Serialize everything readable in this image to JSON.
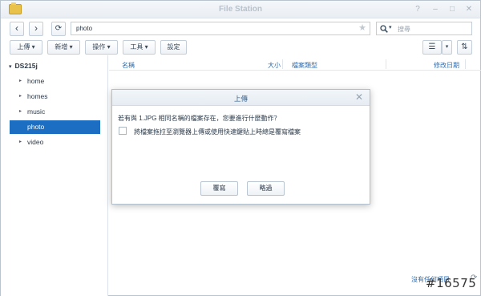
{
  "window": {
    "title": "File Station",
    "controls": [
      "?",
      "–",
      "□",
      "✕"
    ]
  },
  "nav": {
    "back": "‹",
    "forward": "›",
    "refresh": "⟳"
  },
  "path": {
    "value": "photo",
    "star": "★"
  },
  "search": {
    "placeholder": "搜尋",
    "icon": "search-icon",
    "dropdown": "▾"
  },
  "toolbar": {
    "upload": "上傳 ▾",
    "create": "新增 ▾",
    "action": "操作 ▾",
    "tools": "工具 ▾",
    "settings": "設定",
    "view_menu": "☰",
    "view_dropdown": "▾",
    "sort": "⇅"
  },
  "sidebar": {
    "root": "DS215j",
    "root_arrow": "▾",
    "items": [
      {
        "label": "home",
        "arrow": "▸"
      },
      {
        "label": "homes",
        "arrow": "▸"
      },
      {
        "label": "music",
        "arrow": "▸"
      },
      {
        "label": "photo",
        "arrow": ""
      },
      {
        "label": "video",
        "arrow": "▸"
      }
    ],
    "selected": "photo"
  },
  "list": {
    "columns": [
      "名稱",
      "大小",
      "檔案類型",
      "修改日期"
    ]
  },
  "status": {
    "text": "沒有任何項目",
    "refresh": "⟳"
  },
  "watermark": "#16575",
  "dialog": {
    "title": "上傳",
    "close": "✕",
    "message": "若有與 1.JPG 相同名稱的檔案存在，您要進行什麼動作？",
    "checkbox_label": "將檔案拖拉至瀏覽器上傳或使用快速鍵貼上時總是覆寫檔案",
    "buttons": {
      "overwrite": "覆寫",
      "skip": "略過"
    }
  }
}
